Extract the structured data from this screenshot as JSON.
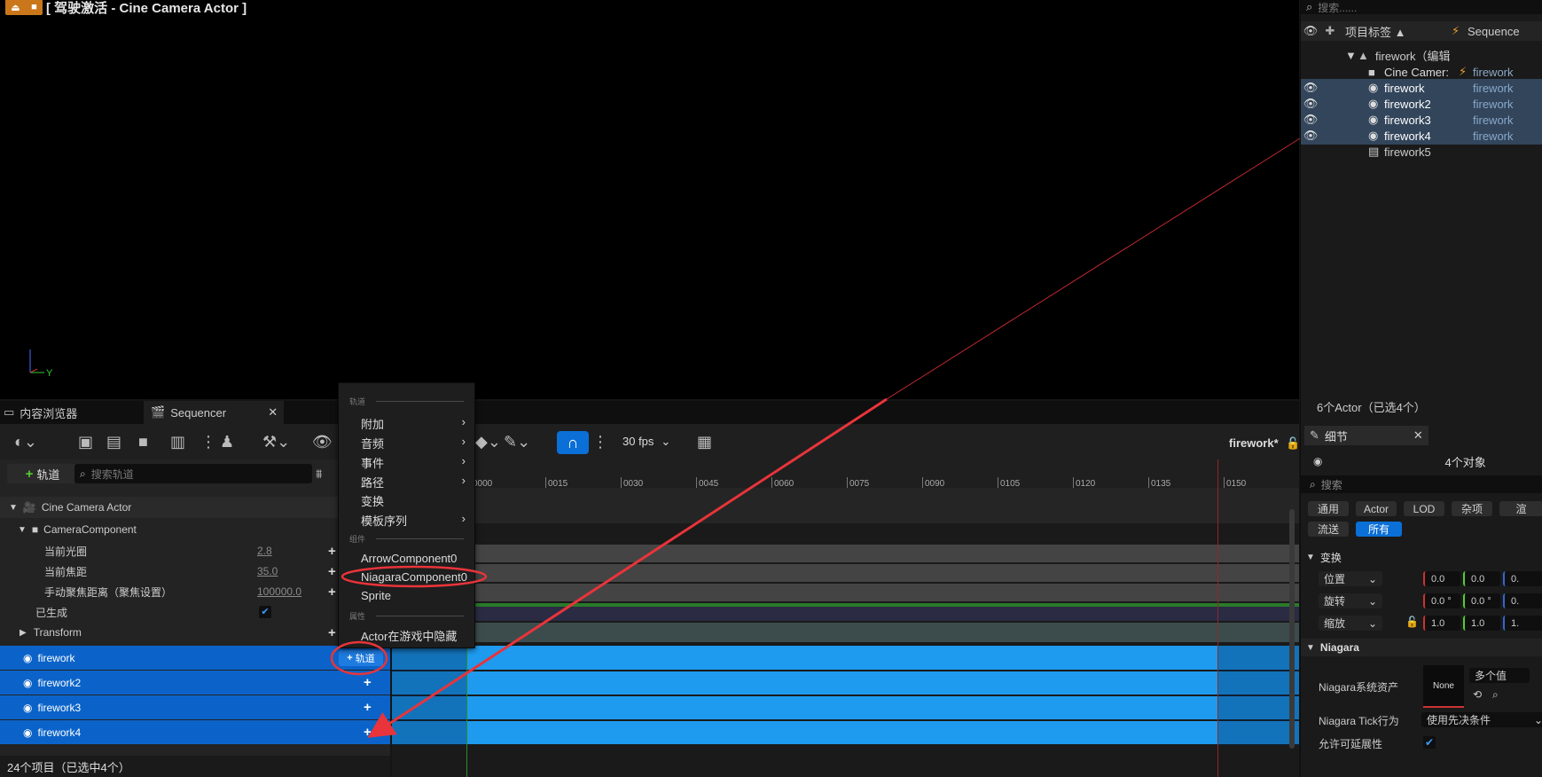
{
  "viewport": {
    "title": "[ 驾驶激活 - Cine Camera Actor ]",
    "axis_labels": {
      "y": "Y"
    }
  },
  "outliner": {
    "search_placeholder": "搜索......",
    "header": {
      "label_col": "项目标签 ▲",
      "type_col": "Sequence"
    },
    "rows": [
      {
        "name": "firework（编辑",
        "type": "",
        "indent": 1,
        "selected": false,
        "eye": false
      },
      {
        "name": "Cine Camer:",
        "type": "firework",
        "indent": 2,
        "selected": false,
        "eye": false
      },
      {
        "name": "firework",
        "type": "firework",
        "indent": 2,
        "selected": true,
        "eye": true
      },
      {
        "name": "firework2",
        "type": "firework",
        "indent": 2,
        "selected": true,
        "eye": true
      },
      {
        "name": "firework3",
        "type": "firework",
        "indent": 2,
        "selected": true,
        "eye": true
      },
      {
        "name": "firework4",
        "type": "firework",
        "indent": 2,
        "selected": true,
        "eye": true
      },
      {
        "name": "firework5",
        "type": "",
        "indent": 2,
        "selected": false,
        "eye": false
      }
    ],
    "status": "6个Actor（已选4个）"
  },
  "details": {
    "tab_label": "细节",
    "object_count": "4个对象",
    "search_placeholder": "搜索",
    "filter_buttons": [
      "通用",
      "Actor",
      "LOD",
      "杂项",
      "流送",
      "所有"
    ],
    "transform_section": "变换",
    "location_label": "位置",
    "rotation_label": "旋转",
    "scale_label": "缩放",
    "location_values": [
      "0.0",
      "0.0"
    ],
    "rotation_values": [
      "0.0 °",
      "0.0 °"
    ],
    "scale_values": [
      "1.0",
      "1.0"
    ],
    "niagara_section": "Niagara",
    "niagara_asset_label": "Niagara系统资产",
    "niagara_asset_value": "None",
    "niagara_multi": "多个值",
    "niagara_tick_label": "Niagara Tick行为",
    "niagara_tick_value": "使用先决条件",
    "allow_scalability_label": "允许可延展性"
  },
  "sequencer": {
    "tabs": [
      "内容浏览器",
      "Sequencer"
    ],
    "fps": "30 fps",
    "sequence_name": "firework*",
    "add_track_button": "轨道",
    "search_placeholder": "搜索轨道",
    "tracks": {
      "cine_camera": "Cine Camera Actor",
      "camera_component": "CameraComponent",
      "aperture_label": "当前光圈",
      "aperture_value": "2.8",
      "focal_label": "当前焦距",
      "focal_value": "35.0",
      "focus_label": "手动聚焦距离（聚焦设置）",
      "focus_value": "100000.0",
      "spawned_label": "已生成",
      "transform_label": "Transform",
      "fireworks": [
        "firework",
        "firework2",
        "firework3",
        "firework4"
      ],
      "inline_track_button": "轨道"
    },
    "ruler_ticks": [
      "0000",
      "0015",
      "0030",
      "0045",
      "0060",
      "0075",
      "0090",
      "0105",
      "0120",
      "0135",
      "0150"
    ],
    "status": "24个项目（已选中4个）"
  },
  "context_menu": {
    "section_tracks": "轨道",
    "items_tracks": [
      {
        "label": "附加",
        "submenu": true
      },
      {
        "label": "音频",
        "submenu": true
      },
      {
        "label": "事件",
        "submenu": true
      },
      {
        "label": "路径",
        "submenu": true
      },
      {
        "label": "变换",
        "submenu": false
      },
      {
        "label": "模板序列",
        "submenu": true
      }
    ],
    "section_components": "组件",
    "items_components": [
      "ArrowComponent0",
      "NiagaraComponent0",
      "Sprite"
    ],
    "section_properties": "属性",
    "items_properties": [
      "Actor在游戏中隐藏"
    ]
  },
  "colors": {
    "accent_blue": "#0b63c9",
    "timeline_blue": "#1e9bef",
    "annotation_red": "#e8343a"
  }
}
